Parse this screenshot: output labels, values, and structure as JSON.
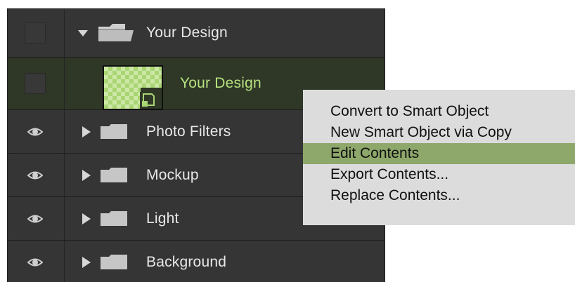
{
  "layers_panel": {
    "layers": [
      {
        "name": "Your Design",
        "kind": "group",
        "expanded": true,
        "visible": false
      },
      {
        "name": "Your Design",
        "kind": "smart-object",
        "selected": true,
        "visible": false
      },
      {
        "name": "Photo Filters",
        "kind": "group",
        "expanded": false,
        "visible": true
      },
      {
        "name": "Mockup",
        "kind": "group",
        "expanded": false,
        "visible": true
      },
      {
        "name": "Light",
        "kind": "group",
        "expanded": false,
        "visible": true
      },
      {
        "name": "Background",
        "kind": "group",
        "expanded": false,
        "visible": true
      }
    ]
  },
  "context_menu": {
    "items": [
      {
        "label": "Convert to Smart Object",
        "highlighted": false
      },
      {
        "label": "New Smart Object via Copy",
        "highlighted": false
      },
      {
        "label": "Edit Contents",
        "highlighted": true
      },
      {
        "label": "Export Contents...",
        "highlighted": false
      },
      {
        "label": "Replace Contents...",
        "highlighted": false
      }
    ]
  },
  "icons": {
    "visibility": "eye-icon",
    "group": "folder-icon",
    "expand": "triangle-icon",
    "smart_object": "smart-object-icon"
  },
  "colors": {
    "panel_bg": "#333333",
    "selected_row_bg": "#2f3727",
    "selected_label": "#b7e27e",
    "menu_bg": "#dcdcdc",
    "menu_highlight": "#8ea86b"
  }
}
